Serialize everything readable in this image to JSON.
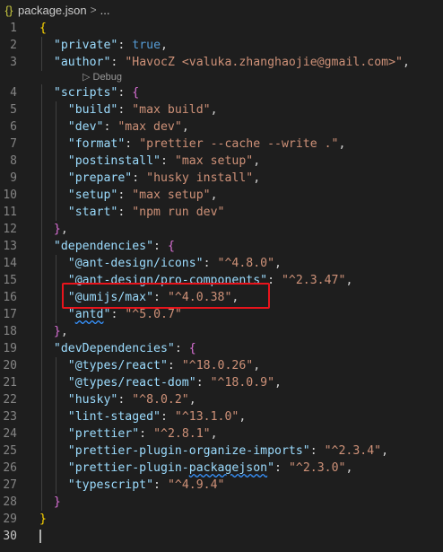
{
  "breadcrumb": {
    "file": "package.json",
    "separator": ">",
    "more": "..."
  },
  "codelens": {
    "label": "Debug"
  },
  "lines": [
    {
      "n": "1",
      "tokens": [
        [
          "br1",
          "{"
        ]
      ]
    },
    {
      "n": "2",
      "tokens": [
        [
          "p",
          "  "
        ],
        [
          "k",
          "\"private\""
        ],
        [
          "p",
          ": "
        ],
        [
          "b",
          "true"
        ],
        [
          "p",
          ","
        ]
      ]
    },
    {
      "n": "3",
      "tokens": [
        [
          "p",
          "  "
        ],
        [
          "k",
          "\"author\""
        ],
        [
          "p",
          ": "
        ],
        [
          "s",
          "\"HavocZ <valuka.zhanghaojie@gmail.com>\""
        ],
        [
          "p",
          ","
        ]
      ]
    },
    {
      "n": "4",
      "tokens": [
        [
          "p",
          "  "
        ],
        [
          "k",
          "\"scripts\""
        ],
        [
          "p",
          ": "
        ],
        [
          "br2",
          "{"
        ]
      ]
    },
    {
      "n": "5",
      "tokens": [
        [
          "p",
          "    "
        ],
        [
          "k",
          "\"build\""
        ],
        [
          "p",
          ": "
        ],
        [
          "s",
          "\"max build\""
        ],
        [
          "p",
          ","
        ]
      ]
    },
    {
      "n": "6",
      "tokens": [
        [
          "p",
          "    "
        ],
        [
          "k",
          "\"dev\""
        ],
        [
          "p",
          ": "
        ],
        [
          "s",
          "\"max dev\""
        ],
        [
          "p",
          ","
        ]
      ]
    },
    {
      "n": "7",
      "tokens": [
        [
          "p",
          "    "
        ],
        [
          "k",
          "\"format\""
        ],
        [
          "p",
          ": "
        ],
        [
          "s",
          "\"prettier --cache --write .\""
        ],
        [
          "p",
          ","
        ]
      ]
    },
    {
      "n": "8",
      "tokens": [
        [
          "p",
          "    "
        ],
        [
          "k",
          "\"postinstall\""
        ],
        [
          "p",
          ": "
        ],
        [
          "s",
          "\"max setup\""
        ],
        [
          "p",
          ","
        ]
      ]
    },
    {
      "n": "9",
      "tokens": [
        [
          "p",
          "    "
        ],
        [
          "k",
          "\"prepare\""
        ],
        [
          "p",
          ": "
        ],
        [
          "s",
          "\"husky install\""
        ],
        [
          "p",
          ","
        ]
      ]
    },
    {
      "n": "10",
      "tokens": [
        [
          "p",
          "    "
        ],
        [
          "k",
          "\"setup\""
        ],
        [
          "p",
          ": "
        ],
        [
          "s",
          "\"max setup\""
        ],
        [
          "p",
          ","
        ]
      ]
    },
    {
      "n": "11",
      "tokens": [
        [
          "p",
          "    "
        ],
        [
          "k",
          "\"start\""
        ],
        [
          "p",
          ": "
        ],
        [
          "s",
          "\"npm run dev\""
        ]
      ]
    },
    {
      "n": "12",
      "tokens": [
        [
          "p",
          "  "
        ],
        [
          "br2",
          "}"
        ],
        [
          "p",
          ","
        ]
      ]
    },
    {
      "n": "13",
      "tokens": [
        [
          "p",
          "  "
        ],
        [
          "k",
          "\"dependencies\""
        ],
        [
          "p",
          ": "
        ],
        [
          "br2",
          "{"
        ]
      ]
    },
    {
      "n": "14",
      "tokens": [
        [
          "p",
          "    "
        ],
        [
          "k",
          "\"@ant-design/icons\""
        ],
        [
          "p",
          ": "
        ],
        [
          "s",
          "\"^4.8.0\""
        ],
        [
          "p",
          ","
        ]
      ]
    },
    {
      "n": "15",
      "tokens": [
        [
          "p",
          "    "
        ],
        [
          "k",
          "\"@ant-design/pro-components\""
        ],
        [
          "p",
          ": "
        ],
        [
          "s",
          "\"^2.3.47\""
        ],
        [
          "p",
          ","
        ]
      ]
    },
    {
      "n": "16",
      "tokens": [
        [
          "p",
          "    "
        ],
        [
          "k",
          "\"@umijs/max\""
        ],
        [
          "p",
          ": "
        ],
        [
          "s",
          "\"^4.0.38\""
        ],
        [
          "p",
          ","
        ]
      ]
    },
    {
      "n": "17",
      "tokens": [
        [
          "p",
          "    "
        ],
        [
          "k",
          "\""
        ],
        [
          "ksq",
          "antd"
        ],
        [
          "k",
          "\""
        ],
        [
          "p",
          ": "
        ],
        [
          "s",
          "\"^5.0.7\""
        ]
      ]
    },
    {
      "n": "18",
      "tokens": [
        [
          "p",
          "  "
        ],
        [
          "br2",
          "}"
        ],
        [
          "p",
          ","
        ]
      ]
    },
    {
      "n": "19",
      "tokens": [
        [
          "p",
          "  "
        ],
        [
          "k",
          "\"devDependencies\""
        ],
        [
          "p",
          ": "
        ],
        [
          "br2",
          "{"
        ]
      ]
    },
    {
      "n": "20",
      "tokens": [
        [
          "p",
          "    "
        ],
        [
          "k",
          "\"@types/react\""
        ],
        [
          "p",
          ": "
        ],
        [
          "s",
          "\"^18.0.26\""
        ],
        [
          "p",
          ","
        ]
      ]
    },
    {
      "n": "21",
      "tokens": [
        [
          "p",
          "    "
        ],
        [
          "k",
          "\"@types/react-dom\""
        ],
        [
          "p",
          ": "
        ],
        [
          "s",
          "\"^18.0.9\""
        ],
        [
          "p",
          ","
        ]
      ]
    },
    {
      "n": "22",
      "tokens": [
        [
          "p",
          "    "
        ],
        [
          "k",
          "\"husky\""
        ],
        [
          "p",
          ": "
        ],
        [
          "s",
          "\"^8.0.2\""
        ],
        [
          "p",
          ","
        ]
      ]
    },
    {
      "n": "23",
      "tokens": [
        [
          "p",
          "    "
        ],
        [
          "k",
          "\"lint-staged\""
        ],
        [
          "p",
          ": "
        ],
        [
          "s",
          "\"^13.1.0\""
        ],
        [
          "p",
          ","
        ]
      ]
    },
    {
      "n": "24",
      "tokens": [
        [
          "p",
          "    "
        ],
        [
          "k",
          "\"prettier\""
        ],
        [
          "p",
          ": "
        ],
        [
          "s",
          "\"^2.8.1\""
        ],
        [
          "p",
          ","
        ]
      ]
    },
    {
      "n": "25",
      "tokens": [
        [
          "p",
          "    "
        ],
        [
          "k",
          "\"prettier-plugin-organize-imports\""
        ],
        [
          "p",
          ": "
        ],
        [
          "s",
          "\"^2.3.4\""
        ],
        [
          "p",
          ","
        ]
      ]
    },
    {
      "n": "26",
      "tokens": [
        [
          "p",
          "    "
        ],
        [
          "k",
          "\"prettier-plugin-"
        ],
        [
          "ksq",
          "packagejson"
        ],
        [
          "k",
          "\""
        ],
        [
          "p",
          ": "
        ],
        [
          "s",
          "\"^2.3.0\""
        ],
        [
          "p",
          ","
        ]
      ]
    },
    {
      "n": "27",
      "tokens": [
        [
          "p",
          "    "
        ],
        [
          "k",
          "\"typescript\""
        ],
        [
          "p",
          ": "
        ],
        [
          "s",
          "\"^4.9.4\""
        ]
      ]
    },
    {
      "n": "28",
      "tokens": [
        [
          "p",
          "  "
        ],
        [
          "br2",
          "}"
        ]
      ]
    },
    {
      "n": "29",
      "tokens": [
        [
          "br1",
          "}"
        ]
      ]
    },
    {
      "n": "30",
      "tokens": []
    }
  ],
  "highlight": {
    "line": "16",
    "color": "#e8141c"
  },
  "colors": {
    "key": "#9cdcfe",
    "string": "#ce9178",
    "keyword": "#569cd6",
    "background": "#1e1e1e"
  }
}
